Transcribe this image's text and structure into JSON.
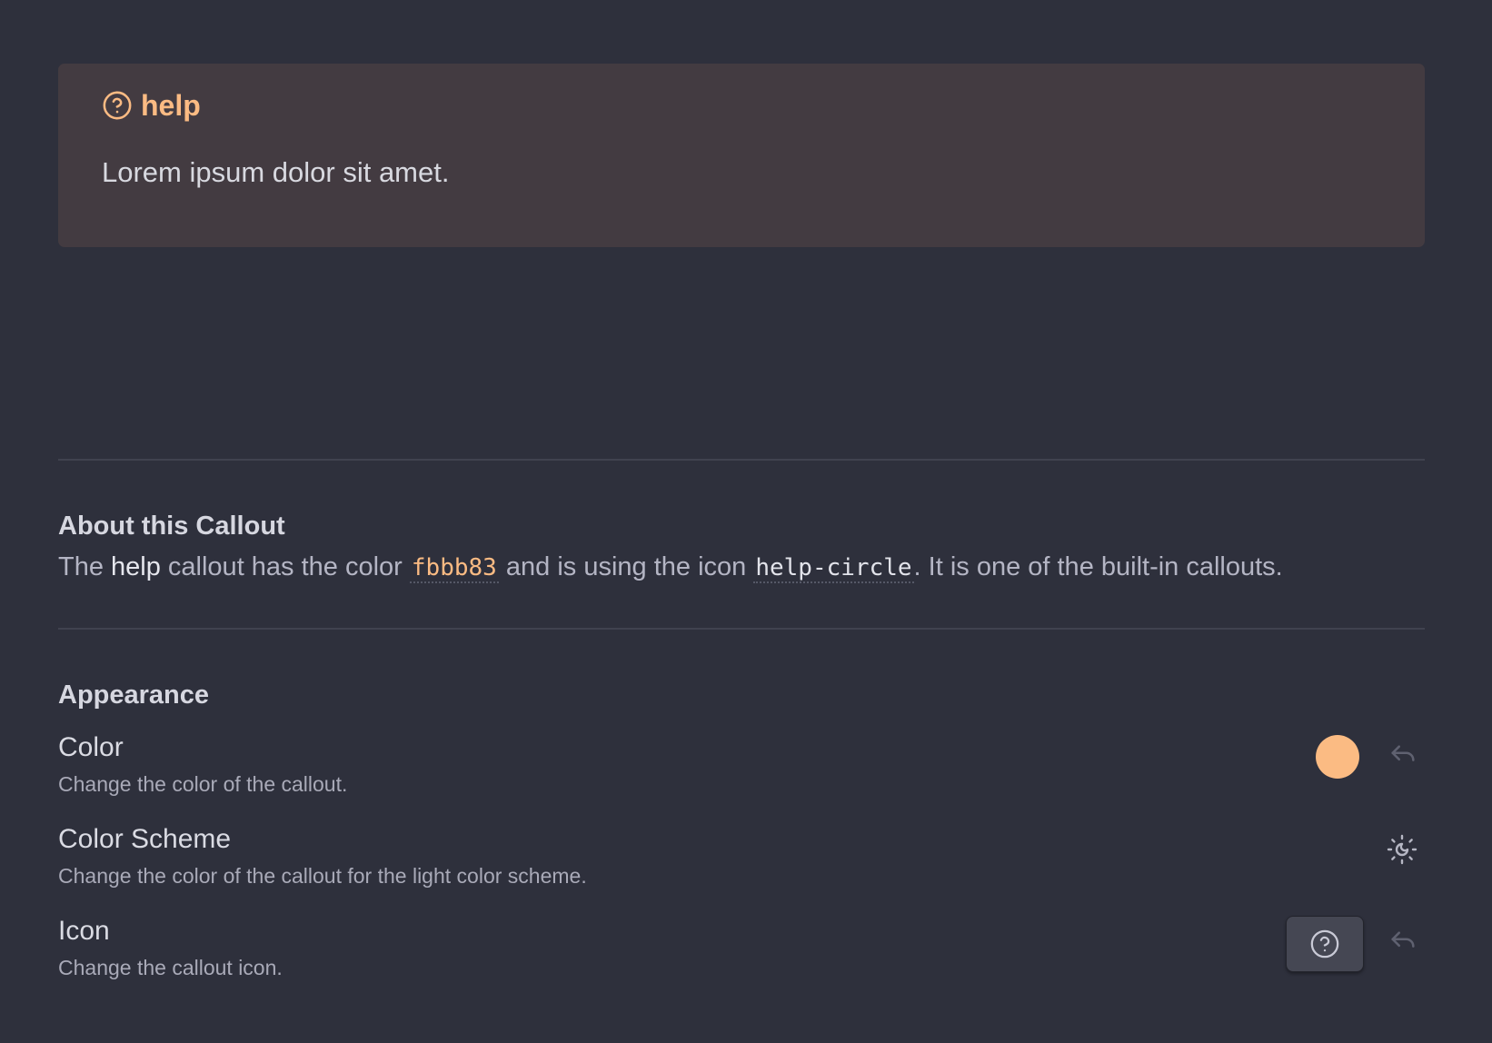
{
  "callout_preview": {
    "title": "help",
    "icon": "help-circle-icon",
    "body": "Lorem ipsum dolor sit amet.",
    "accent_color": "#fbbb83"
  },
  "about": {
    "heading": "About this Callout",
    "text_1": "The ",
    "callout_name": "help",
    "text_2": " callout has the color ",
    "color_code": "fbbb83",
    "text_3": " and is using the icon ",
    "icon_code": "help-circle",
    "text_4": ". It is one of the built-in callouts."
  },
  "appearance": {
    "heading": "Appearance",
    "settings": [
      {
        "name": "Color",
        "description": "Change the color of the callout.",
        "swatch_color": "#fbbb83",
        "reset_icon": "undo-icon"
      },
      {
        "name": "Color Scheme",
        "description": "Change the color of the callout for the light color scheme.",
        "toggle_icon": "sun-moon-icon"
      },
      {
        "name": "Icon",
        "description": "Change the callout icon.",
        "button_icon": "help-circle-icon",
        "reset_icon": "undo-icon"
      }
    ]
  }
}
